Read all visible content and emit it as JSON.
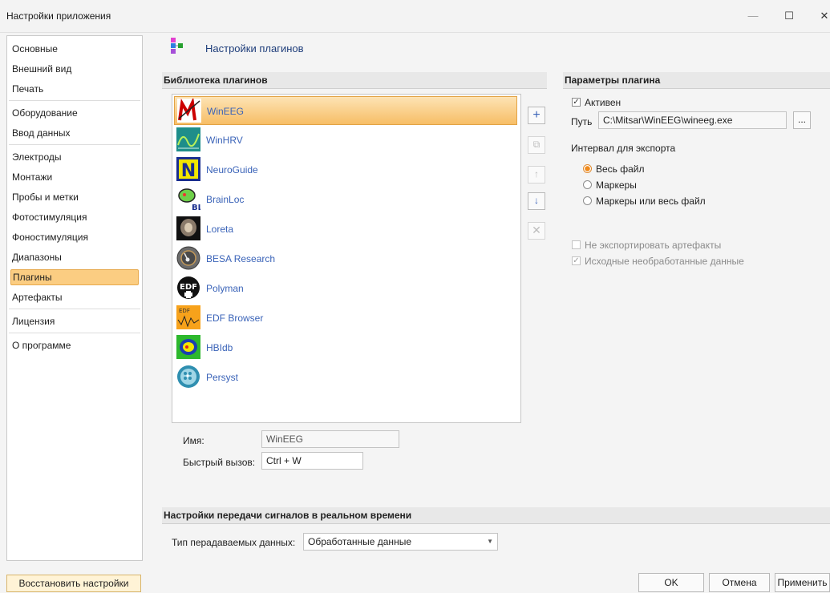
{
  "window": {
    "title": "Настройки приложения",
    "minimize": "—",
    "maximize": "☐",
    "close": "✕"
  },
  "nav": {
    "items": [
      {
        "label": "Основные"
      },
      {
        "label": "Внешний вид"
      },
      {
        "label": "Печать"
      },
      {
        "label": "Оборудование"
      },
      {
        "label": "Ввод данных"
      },
      {
        "label": "Электроды"
      },
      {
        "label": "Монтажи"
      },
      {
        "label": "Пробы и метки"
      },
      {
        "label": "Фотостимуляция"
      },
      {
        "label": "Фоностимуляция"
      },
      {
        "label": "Диапазоны"
      },
      {
        "label": "Плагины",
        "selected": true
      },
      {
        "label": "Артефакты"
      },
      {
        "label": "Лицензия"
      },
      {
        "label": "О программе"
      }
    ],
    "restore_label": "Восстановить настройки"
  },
  "header": {
    "title": "Настройки плагинов",
    "icon": "plugins-settings-icon"
  },
  "library": {
    "title": "Библиотека плагинов",
    "plugins": [
      {
        "name": "WinEEG",
        "icon": "wineeg-icon",
        "selected": true
      },
      {
        "name": "WinHRV",
        "icon": "winhrv-icon"
      },
      {
        "name": "NeuroGuide",
        "icon": "neuroguide-icon"
      },
      {
        "name": "BrainLoc",
        "icon": "brainloc-icon"
      },
      {
        "name": "Loreta",
        "icon": "loreta-icon"
      },
      {
        "name": "BESA Research",
        "icon": "besa-icon"
      },
      {
        "name": "Polyman",
        "icon": "polyman-icon"
      },
      {
        "name": "EDF Browser",
        "icon": "edf-browser-icon"
      },
      {
        "name": "HBIdb",
        "icon": "hbidb-icon"
      },
      {
        "name": "Persyst",
        "icon": "persyst-icon"
      }
    ],
    "name_label": "Имя:",
    "name_value": "WinEEG",
    "hotkey_label": "Быстрый вызов:",
    "hotkey_value": "Ctrl + W"
  },
  "params": {
    "title": "Параметры плагина",
    "active_label": "Активен",
    "active_checked": true,
    "path_label": "Путь",
    "path_value": "C:\\Mitsar\\WinEEG\\wineeg.exe",
    "browse_label": "...",
    "interval_title": "Интервал для экспорта",
    "interval_options": [
      {
        "label": "Весь файл",
        "selected": true
      },
      {
        "label": "Маркеры"
      },
      {
        "label": "Маркеры или весь файл"
      }
    ],
    "no_artifacts_label": "Не экспортировать артефакты",
    "raw_data_label": "Исходные необработанные данные"
  },
  "realtime": {
    "title": "Настройки передачи сигналов в реальном времени",
    "data_type_label": "Тип перадаваемых данных:",
    "data_type_value": "Обработанные данные"
  },
  "footer": {
    "ok": "OK",
    "cancel": "Отмена",
    "apply": "Применить"
  },
  "colors": {
    "selection": "#fbcd82",
    "selection_border": "#e7a94c",
    "link": "#3a63b8"
  }
}
